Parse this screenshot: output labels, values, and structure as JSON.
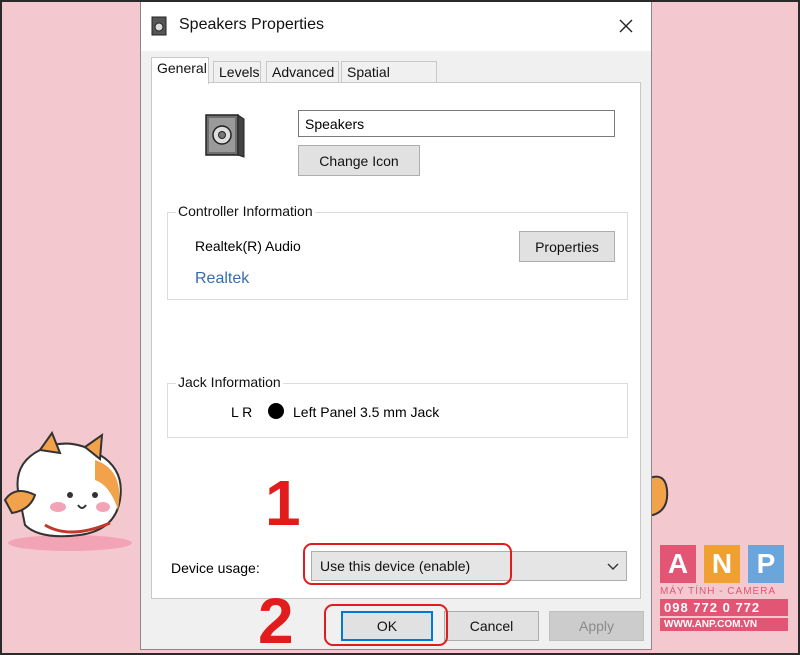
{
  "window": {
    "title": "Speakers Properties"
  },
  "tabs": [
    {
      "label": "General"
    },
    {
      "label": "Levels"
    },
    {
      "label": "Advanced"
    },
    {
      "label": "Spatial sound"
    }
  ],
  "general": {
    "device_name_value": "Speakers",
    "change_icon_label": "Change Icon",
    "controller": {
      "group_label": "Controller Information",
      "name": "Realtek(R) Audio",
      "link": "Realtek",
      "properties_label": "Properties"
    },
    "jack": {
      "group_label": "Jack Information",
      "channels": "L R",
      "description": "Left Panel 3.5 mm Jack"
    },
    "usage": {
      "label": "Device usage:",
      "selected": "Use this device (enable)"
    }
  },
  "footer": {
    "ok_label": "OK",
    "cancel_label": "Cancel",
    "apply_label": "Apply"
  },
  "annotations": {
    "step1": "1",
    "step2": "2",
    "color": "#e21c1c"
  },
  "logo": {
    "letters": [
      "A",
      "N",
      "P"
    ],
    "letter_colors": [
      "#e25575",
      "#f0a030",
      "#6aa6dc"
    ],
    "tagline": "MÁY TÍNH - CAMERA",
    "phone": "098 772 0 772",
    "website": "WWW.ANP.COM.VN"
  }
}
